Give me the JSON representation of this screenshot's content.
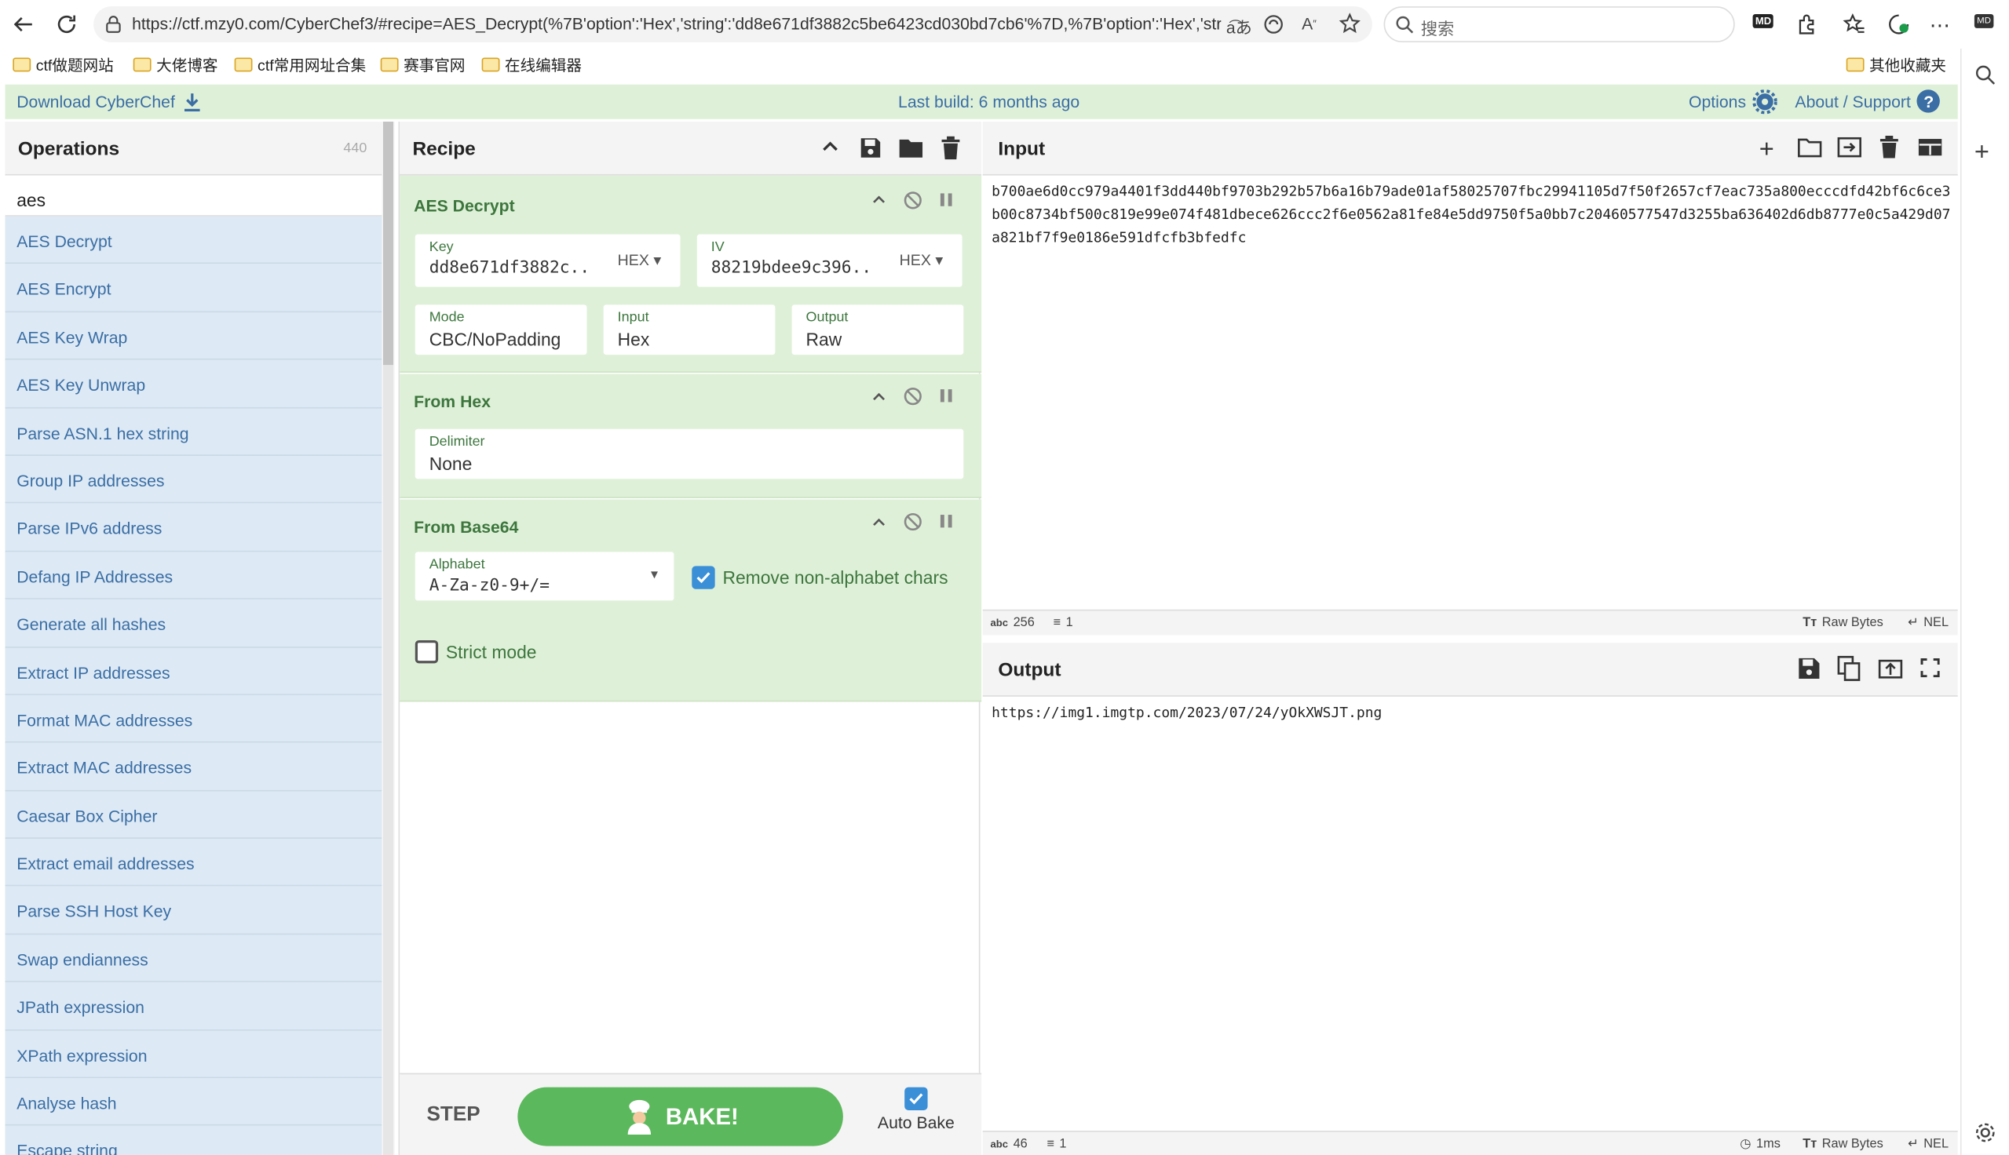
{
  "browser": {
    "url": "https://ctf.mzy0.com/CyberChef3/#recipe=AES_Decrypt(%7B'option':'Hex','string':'dd8e671df3882c5be6423cd030bd7cb6'%7D,%7B'option':'Hex','str...",
    "search_placeholder": "搜索",
    "bookmarks": [
      "ctf做题网站",
      "大佬博客",
      "ctf常用网址合集",
      "赛事官网",
      "在线编辑器"
    ],
    "other_bookmarks": "其他收藏夹"
  },
  "banner": {
    "download": "Download CyberChef",
    "last_build": "Last build: 6 months ago",
    "options": "Options",
    "about": "About / Support"
  },
  "operations": {
    "title": "Operations",
    "count": "440",
    "search_value": "aes",
    "items": [
      "AES Decrypt",
      "AES Encrypt",
      "AES Key Wrap",
      "AES Key Unwrap",
      "Parse ASN.1 hex string",
      "Group IP addresses",
      "Parse IPv6 address",
      "Defang IP Addresses",
      "Generate all hashes",
      "Extract IP addresses",
      "Format MAC addresses",
      "Extract MAC addresses",
      "Caesar Box Cipher",
      "Extract email addresses",
      "Parse SSH Host Key",
      "Swap endianness",
      "JPath expression",
      "XPath expression",
      "Analyse hash",
      "Escape string"
    ]
  },
  "recipe": {
    "title": "Recipe",
    "aes": {
      "title": "AES Decrypt",
      "key_label": "Key",
      "key_value": "dd8e671df3882c...",
      "key_format": "HEX",
      "iv_label": "IV",
      "iv_value": "88219bdee9c396...",
      "iv_format": "HEX",
      "mode_label": "Mode",
      "mode_value": "CBC/NoPadding",
      "input_label": "Input",
      "input_value": "Hex",
      "output_label": "Output",
      "output_value": "Raw"
    },
    "fromhex": {
      "title": "From Hex",
      "delim_label": "Delimiter",
      "delim_value": "None"
    },
    "frombase64": {
      "title": "From Base64",
      "alphabet_label": "Alphabet",
      "alphabet_value": "A-Za-z0-9+/=",
      "remove_label": "Remove non-alphabet chars",
      "strict_label": "Strict mode"
    },
    "step": "STEP",
    "bake": "BAKE!",
    "autobake": "Auto Bake"
  },
  "input": {
    "title": "Input",
    "text": "b700ae6d0cc979a4401f3dd440bf9703b292b57b6a16b79ade01af58025707fbc29941105d7f50f2657cf7eac735a800ecccdfd42bf6c6ce3b00c8734bf500c819e99e074f481dbece626ccc2f6e0562a81fe84e5dd9750f5a0bb7c20460577547d3255ba636402d6db8777e0c5a429d07a821bf7f9e0186e591dfcfb3bfedfc",
    "length": "256",
    "lines": "1",
    "encoding": "Raw Bytes",
    "eol": "NEL"
  },
  "output": {
    "title": "Output",
    "text": "https://img1.imgtp.com/2023/07/24/yOkXWSJT.png",
    "length": "46",
    "lines": "1",
    "time": "1ms",
    "encoding": "Raw Bytes",
    "eol": "NEL"
  },
  "colors": {
    "accent_blue": "#3a6ea5",
    "green": "#5cb85c",
    "recipe_bg": "#dff0d8"
  }
}
